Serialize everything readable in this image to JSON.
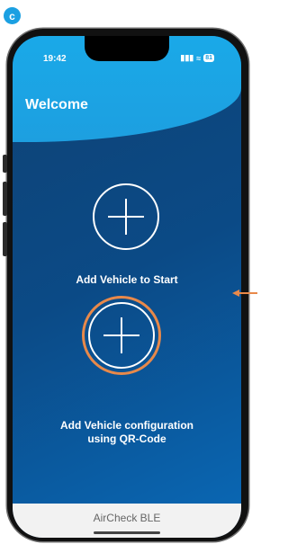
{
  "figure_label": "c",
  "status_bar": {
    "time": "19:42",
    "signal": "▮▮▮",
    "wifi": "≈",
    "battery": "81"
  },
  "header": {
    "title": "Welcome"
  },
  "actions": {
    "add_vehicle": {
      "label": "Add Vehicle to Start"
    },
    "add_vehicle_qr": {
      "label_line1": "Add Vehicle configuration",
      "label_line2": "using QR-Code"
    }
  },
  "footer": {
    "app_name": "AirCheck BLE"
  },
  "colors": {
    "header": "#1d9fe0",
    "background": "#0b4a86",
    "highlight_ring": "#e8894a",
    "pointer_arrow": "#e8894a"
  }
}
